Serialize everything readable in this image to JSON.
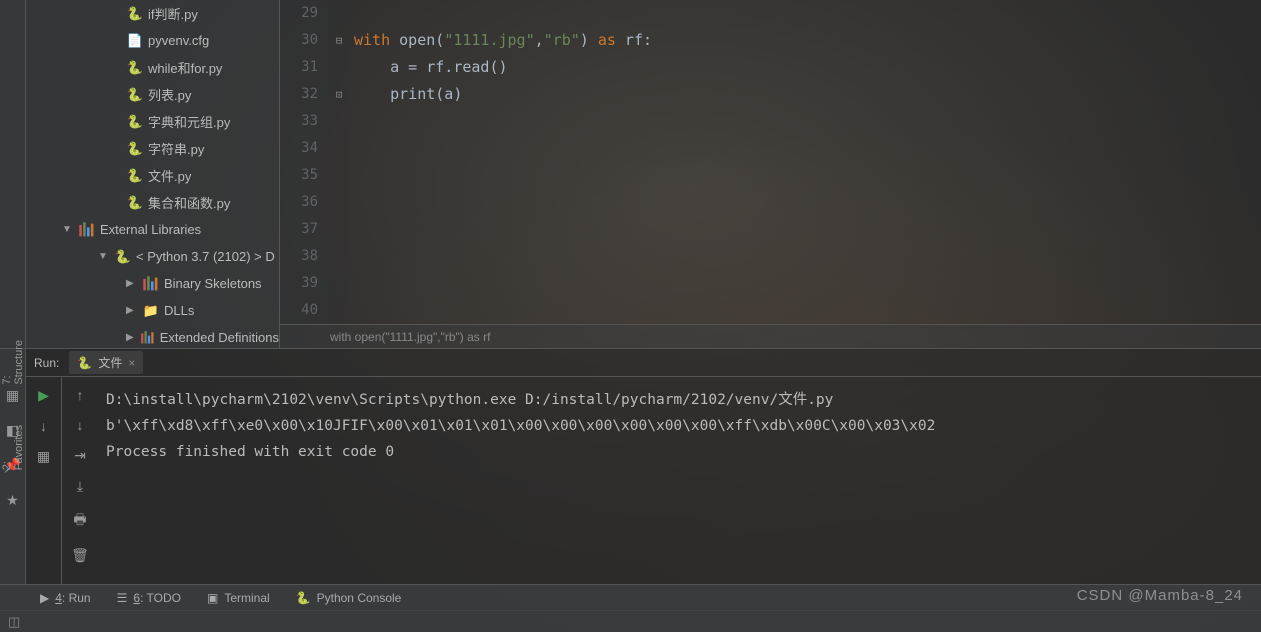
{
  "sidebar": {
    "files": [
      {
        "name": "if判断.py",
        "type": "py"
      },
      {
        "name": "pyvenv.cfg",
        "type": "cfg"
      },
      {
        "name": "while和for.py",
        "type": "py"
      },
      {
        "name": "列表.py",
        "type": "py"
      },
      {
        "name": "字典和元组.py",
        "type": "py"
      },
      {
        "name": "字符串.py",
        "type": "py"
      },
      {
        "name": "文件.py",
        "type": "py"
      },
      {
        "name": "集合和函数.py",
        "type": "py"
      }
    ],
    "external_label": "External Libraries",
    "python_label": "< Python 3.7 (2102) >   D",
    "sub_items": [
      {
        "name": "Binary Skeletons",
        "type": "lib"
      },
      {
        "name": "DLLs",
        "type": "folder"
      },
      {
        "name": "Extended Definitions",
        "type": "lib"
      }
    ]
  },
  "editor": {
    "line_numbers": [
      "29",
      "30",
      "31",
      "32",
      "33",
      "34",
      "35",
      "36",
      "37",
      "38",
      "39",
      "40"
    ],
    "code": {
      "l30_kw1": "with",
      "l30_fn": " open(",
      "l30_str1": "\"1111.jpg\"",
      "l30_c1": ",",
      "l30_str2": "\"rb\"",
      "l30_c2": ") ",
      "l30_kw2": "as",
      "l30_var": " rf:",
      "l31": "    a = rf.read()",
      "l32": "    print(a)"
    },
    "breadcrumb": "with open(\"1111.jpg\",\"rb\") as rf"
  },
  "run": {
    "label": "Run:",
    "tab_name": "文件",
    "output_l1": "D:\\install\\pycharm\\2102\\venv\\Scripts\\python.exe D:/install/pycharm/2102/venv/文件.py",
    "output_l2": "b'\\xff\\xd8\\xff\\xe0\\x00\\x10JFIF\\x00\\x01\\x01\\x01\\x00\\x00\\x00\\x00\\x00\\x00\\xff\\xdb\\x00C\\x00\\x03\\x02",
    "output_l3": "",
    "output_l4": "Process finished with exit code 0"
  },
  "left_strip": {
    "structure": "7: Structure",
    "favorites": "2: Favorites"
  },
  "bottom": {
    "run": "4: Run",
    "todo": "6: TODO",
    "terminal": "Terminal",
    "console": "Python Console"
  },
  "watermark": "CSDN @Mamba-8_24"
}
